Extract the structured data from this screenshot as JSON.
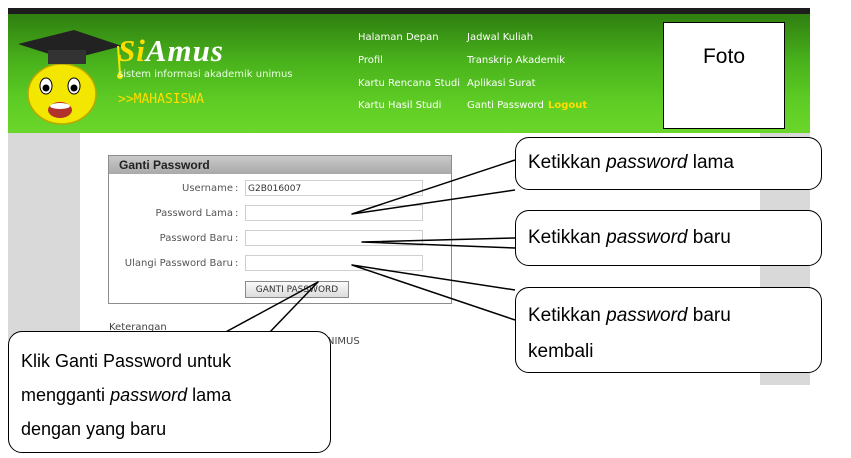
{
  "brand": {
    "title_si": "Si",
    "title_rest": "Amus",
    "subtitle": "sistem informasi akademik unimus",
    "role": ">>MAHASISWA"
  },
  "nav": {
    "halaman_depan": "Halaman Depan",
    "profil": "Profil",
    "kartu_rencana_studi": "Kartu Rencana Studi",
    "kartu_hasil_studi": "Kartu Hasil Studi",
    "jadwal_kuliah": "Jadwal Kuliah",
    "transkrip_akademik": "Transkrip Akademik",
    "aplikasi_surat": "Aplikasi Surat",
    "ganti_password": "Ganti Password",
    "logout": "Logout"
  },
  "foto": "Foto",
  "form": {
    "title": "Ganti Password",
    "colon": ":",
    "username_label": "Username",
    "username_value": "G2B016007",
    "password_lama_label": "Password Lama",
    "password_baru_label": "Password Baru",
    "ulangi_label": "Ulangi Password Baru",
    "button": "GANTI PASSWORD"
  },
  "keterangan": "Keterangan",
  "unimus_text": "NIMUS",
  "callouts": {
    "lama_pre": "Ketikkan ",
    "lama_em": "password",
    "lama_post": " lama",
    "baru_pre": "Ketikkan ",
    "baru_em": "password",
    "baru_post": " baru",
    "kembali_pre": "Ketikkan ",
    "kembali_em": "password",
    "kembali_post": " baru",
    "kembali_line2": "kembali",
    "klik_line1": "Klik Ganti Password untuk",
    "klik_line2_pre": "mengganti ",
    "klik_line2_em": "password",
    "klik_line2_post": " lama",
    "klik_line3": "dengan yang baru"
  },
  "colors": {
    "header_green": "#49b21c",
    "brand_yellow": "#ffde00",
    "panel_gray": "#d9d9d9"
  }
}
